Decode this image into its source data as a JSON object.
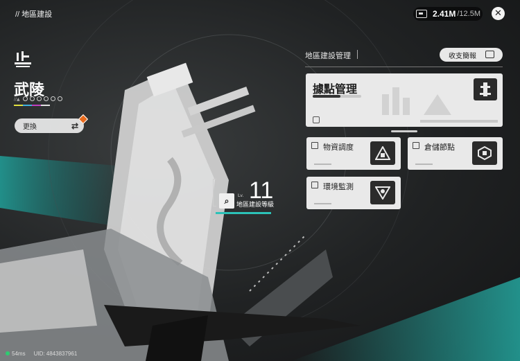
{
  "header": {
    "breadcrumb": "// 地區建設",
    "currency_current": "2.41M",
    "currency_max": "/12.5M",
    "currency_icon": "battery-icon",
    "close_icon": "close-icon"
  },
  "region": {
    "name": "武陵",
    "sub_label": "//▲",
    "switch_label": "更換",
    "switch_icon": "swap-icon"
  },
  "level": {
    "prefix": "Lv.",
    "value": "11",
    "label": "地區建設等級",
    "icon": "magnifier-icon"
  },
  "panel": {
    "title": "地區建設管理",
    "report_label": "收支簡報",
    "report_icon": "calendar-icon",
    "main_card": {
      "label": "據點管理",
      "icon": "tower-icon"
    },
    "cards": [
      {
        "label": "物資調度",
        "icon": "supply-icon"
      },
      {
        "label": "倉儲節點",
        "icon": "storage-icon"
      },
      {
        "label": "環境監測",
        "icon": "monitor-icon"
      }
    ]
  },
  "footer": {
    "ping": "54ms",
    "uid": "UID: 4843837961"
  },
  "colors": {
    "accent_teal": "#2cc2b8",
    "notify_orange": "#e86a1c",
    "card_bg": "#e9e9e9"
  }
}
